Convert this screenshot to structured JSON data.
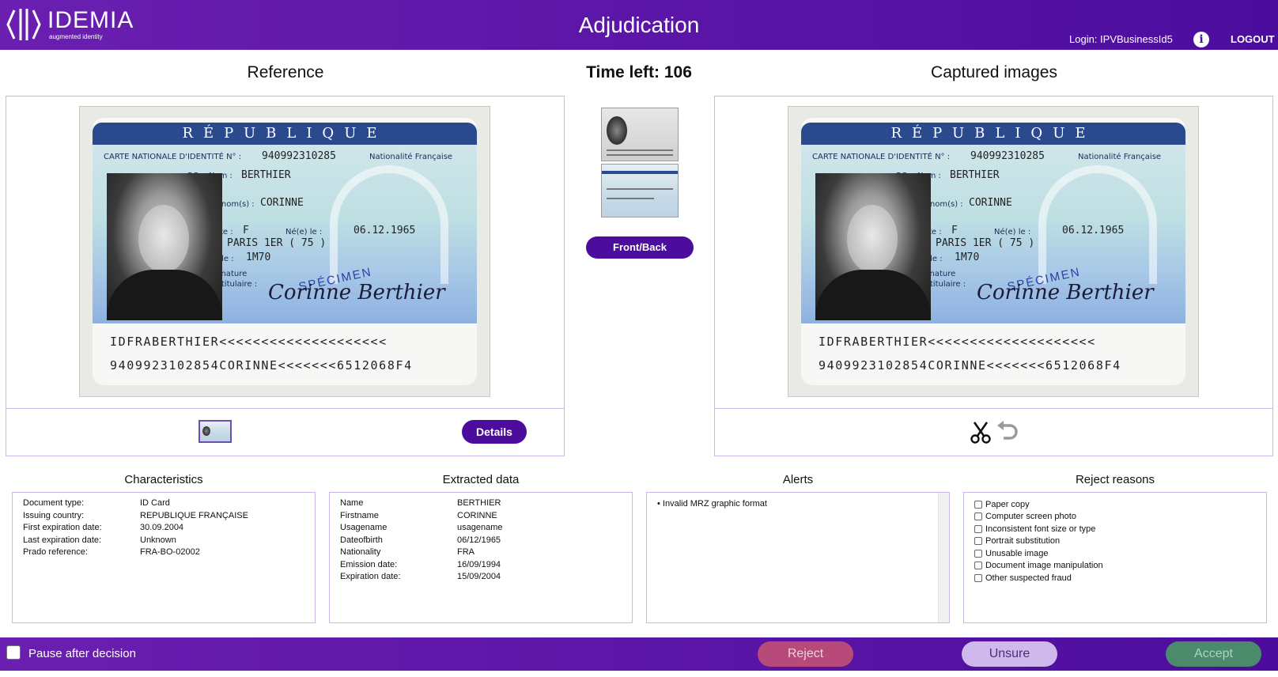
{
  "header": {
    "logo_name": "IDEMIA",
    "logo_tagline": "augmented identity",
    "title": "Adjudication",
    "login": "Login: IPVBusinessId5",
    "logout": "LOGOUT",
    "info_icon": "info-icon"
  },
  "reference": {
    "title": "Reference",
    "details_button": "Details"
  },
  "timer": {
    "label": "Time left: 106",
    "front_back_button": "Front/Back"
  },
  "captured": {
    "title": "Captured images",
    "tools": [
      "scissors-icon",
      "undo-icon"
    ]
  },
  "id_card": {
    "header": "RÉPUBLIQUE FRANÇAISE",
    "carte_label": "CARTE NATIONALE D'IDENTITÉ N° :",
    "card_number": "940992310285",
    "nationality_label": "Nationalité Française",
    "bc": "BC",
    "nom_label": "Nom :",
    "nom": "BERTHIER",
    "prenom_label": "Prénom(s) :",
    "prenom": "CORINNE",
    "sexe_label": "Sexe :",
    "sexe": "F",
    "ne_label": "Né(e) le :",
    "birth": "06.12.1965",
    "a_label": "à :",
    "place": "PARIS 1ER ( 75 )",
    "taille_label": "Taille :",
    "taille": "1M70",
    "signature_label": "Signature",
    "titulaire_label": "du titulaire :",
    "signature": "Corinne Berthier",
    "specimen": "SPÉCIMEN",
    "mrz1": "IDFRABERTHIER<<<<<<<<<<<<<<<<<<<<",
    "mrz2": "9409923102854CORINNE<<<<<<<6512068F4"
  },
  "characteristics": {
    "title": "Characteristics",
    "rows": [
      {
        "k": "Document type:",
        "v": "ID Card"
      },
      {
        "k": "Issuing country:",
        "v": "REPUBLIQUE FRANÇAISE"
      },
      {
        "k": "First expiration date:",
        "v": "30.09.2004"
      },
      {
        "k": "Last expiration date:",
        "v": "Unknown"
      },
      {
        "k": "Prado reference:",
        "v": "FRA-BO-02002"
      }
    ]
  },
  "extracted": {
    "title": "Extracted data",
    "rows": [
      {
        "k": "Name",
        "v": "BERTHIER"
      },
      {
        "k": "Firstname",
        "v": "CORINNE"
      },
      {
        "k": "Usagename",
        "v": "usagename"
      },
      {
        "k": "Dateofbirth",
        "v": "06/12/1965"
      },
      {
        "k": "Nationality",
        "v": "FRA"
      },
      {
        "k": "Emission date:",
        "v": "16/09/1994"
      },
      {
        "k": "Expiration date:",
        "v": "15/09/2004"
      }
    ]
  },
  "alerts": {
    "title": "Alerts",
    "items": [
      "• Invalid MRZ graphic format"
    ]
  },
  "reject_reasons": {
    "title": "Reject reasons",
    "items": [
      "Paper copy",
      "Computer screen photo",
      "Inconsistent font size or type",
      "Portrait substitution",
      "Unusable image",
      "Document image manipulation",
      "Other suspected fraud"
    ]
  },
  "footer": {
    "pause_label": "Pause after decision",
    "reject": "Reject",
    "unsure": "Unsure",
    "accept": "Accept"
  },
  "colors": {
    "header_bg": "#5a16a6",
    "primary_button": "#4c0d9e",
    "reject": "#b84a7a",
    "unsure": "#cfb8ec",
    "accept": "#4c8a6c",
    "panel_border": "#cdb7ea"
  }
}
